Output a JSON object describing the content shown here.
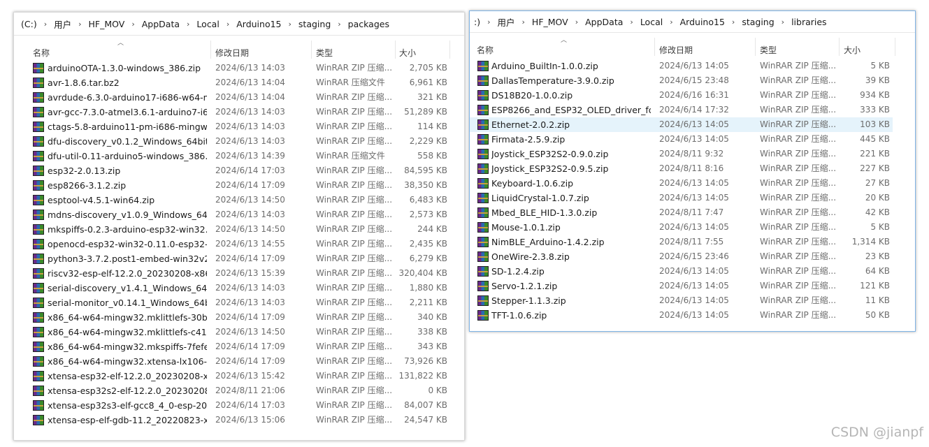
{
  "left_window": {
    "breadcrumb": [
      "(C:)",
      "用户",
      "HF_MOV",
      "AppData",
      "Local",
      "Arduino15",
      "staging",
      "packages"
    ],
    "columns": {
      "name": "名称",
      "date": "修改日期",
      "type": "类型",
      "size": "大小"
    },
    "files": [
      {
        "name": "arduinoOTA-1.3.0-windows_386.zip",
        "date": "2024/6/13 14:03",
        "type": "WinRAR ZIP 压缩...",
        "size": "2,705 KB"
      },
      {
        "name": "avr-1.8.6.tar.bz2",
        "date": "2024/6/13 14:04",
        "type": "WinRAR 压缩文件",
        "size": "6,961 KB"
      },
      {
        "name": "avrdude-6.3.0-arduino17-i686-w64-m...",
        "date": "2024/6/13 14:04",
        "type": "WinRAR ZIP 压缩...",
        "size": "321 KB"
      },
      {
        "name": "avr-gcc-7.3.0-atmel3.6.1-arduino7-i6...",
        "date": "2024/6/13 14:03",
        "type": "WinRAR ZIP 压缩...",
        "size": "51,289 KB"
      },
      {
        "name": "ctags-5.8-arduino11-pm-i686-mingw...",
        "date": "2024/6/13 14:03",
        "type": "WinRAR ZIP 压缩...",
        "size": "114 KB"
      },
      {
        "name": "dfu-discovery_v0.1.2_Windows_64bit....",
        "date": "2024/6/13 14:03",
        "type": "WinRAR ZIP 压缩...",
        "size": "2,229 KB"
      },
      {
        "name": "dfu-util-0.11-arduino5-windows_386.t...",
        "date": "2024/6/13 14:39",
        "type": "WinRAR 压缩文件",
        "size": "558 KB"
      },
      {
        "name": "esp32-2.0.13.zip",
        "date": "2024/6/14 17:03",
        "type": "WinRAR ZIP 压缩...",
        "size": "84,595 KB"
      },
      {
        "name": "esp8266-3.1.2.zip",
        "date": "2024/6/14 17:09",
        "type": "WinRAR ZIP 压缩...",
        "size": "38,350 KB"
      },
      {
        "name": "esptool-v4.5.1-win64.zip",
        "date": "2024/6/13 14:50",
        "type": "WinRAR ZIP 压缩...",
        "size": "6,483 KB"
      },
      {
        "name": "mdns-discovery_v1.0.9_Windows_64b...",
        "date": "2024/6/13 14:03",
        "type": "WinRAR ZIP 压缩...",
        "size": "2,573 KB"
      },
      {
        "name": "mkspiffs-0.2.3-arduino-esp32-win32....",
        "date": "2024/6/13 14:50",
        "type": "WinRAR ZIP 压缩...",
        "size": "244 KB"
      },
      {
        "name": "openocd-esp32-win32-0.11.0-esp32-...",
        "date": "2024/6/13 14:55",
        "type": "WinRAR ZIP 压缩...",
        "size": "2,435 KB"
      },
      {
        "name": "python3-3.7.2.post1-embed-win32v2...",
        "date": "2024/6/14 17:09",
        "type": "WinRAR ZIP 压缩...",
        "size": "6,279 KB"
      },
      {
        "name": "riscv32-esp-elf-12.2.0_20230208-x86_...",
        "date": "2024/6/13 15:39",
        "type": "WinRAR ZIP 压缩...",
        "size": "320,404 KB"
      },
      {
        "name": "serial-discovery_v1.4.1_Windows_64bi...",
        "date": "2024/6/13 14:03",
        "type": "WinRAR ZIP 压缩...",
        "size": "1,880 KB"
      },
      {
        "name": "serial-monitor_v0.14.1_Windows_64bi...",
        "date": "2024/6/13 14:03",
        "type": "WinRAR ZIP 压缩...",
        "size": "2,211 KB"
      },
      {
        "name": "x86_64-w64-mingw32.mklittlefs-30b7f...",
        "date": "2024/6/14 17:09",
        "type": "WinRAR ZIP 压缩...",
        "size": "340 KB"
      },
      {
        "name": "x86_64-w64-mingw32.mklittlefs-c41e...",
        "date": "2024/6/13 14:50",
        "type": "WinRAR ZIP 压缩...",
        "size": "338 KB"
      },
      {
        "name": "x86_64-w64-mingw32.mkspiffs-7fefea...",
        "date": "2024/6/14 17:09",
        "type": "WinRAR ZIP 压缩...",
        "size": "343 KB"
      },
      {
        "name": "x86_64-w64-mingw32.xtensa-lx106-el...",
        "date": "2024/6/14 17:09",
        "type": "WinRAR ZIP 压缩...",
        "size": "73,926 KB"
      },
      {
        "name": "xtensa-esp32-elf-12.2.0_20230208-x8...",
        "date": "2024/6/13 15:42",
        "type": "WinRAR ZIP 压缩...",
        "size": "131,822 KB"
      },
      {
        "name": "xtensa-esp32s2-elf-12.2.0_20230208-...",
        "date": "2024/8/11 21:06",
        "type": "WinRAR ZIP 压缩...",
        "size": "0 KB"
      },
      {
        "name": "xtensa-esp32s3-elf-gcc8_4_0-esp-202...",
        "date": "2024/6/14 17:03",
        "type": "WinRAR ZIP 压缩...",
        "size": "84,007 KB"
      },
      {
        "name": "xtensa-esp-elf-gdb-11.2_20220823-x...",
        "date": "2024/6/13 15:06",
        "type": "WinRAR ZIP 压缩...",
        "size": "24,547 KB"
      }
    ]
  },
  "right_window": {
    "breadcrumb": [
      ":)",
      "用户",
      "HF_MOV",
      "AppData",
      "Local",
      "Arduino15",
      "staging",
      "libraries"
    ],
    "columns": {
      "name": "名称",
      "date": "修改日期",
      "type": "类型",
      "size": "大小"
    },
    "selected_row": 4,
    "files": [
      {
        "name": "Arduino_BuiltIn-1.0.0.zip",
        "date": "2024/6/13 14:05",
        "type": "WinRAR ZIP 压缩...",
        "size": "5 KB"
      },
      {
        "name": "DallasTemperature-3.9.0.zip",
        "date": "2024/6/15 23:48",
        "type": "WinRAR ZIP 压缩...",
        "size": "39 KB"
      },
      {
        "name": "DS18B20-1.0.0.zip",
        "date": "2024/6/16 16:31",
        "type": "WinRAR ZIP 压缩...",
        "size": "934 KB"
      },
      {
        "name": "ESP8266_and_ESP32_OLED_driver_for...",
        "date": "2024/6/14 17:32",
        "type": "WinRAR ZIP 压缩...",
        "size": "333 KB"
      },
      {
        "name": "Ethernet-2.0.2.zip",
        "date": "2024/6/13 14:05",
        "type": "WinRAR ZIP 压缩...",
        "size": "103 KB"
      },
      {
        "name": "Firmata-2.5.9.zip",
        "date": "2024/6/13 14:05",
        "type": "WinRAR ZIP 压缩...",
        "size": "445 KB"
      },
      {
        "name": "Joystick_ESP32S2-0.9.0.zip",
        "date": "2024/8/11 9:32",
        "type": "WinRAR ZIP 压缩...",
        "size": "221 KB"
      },
      {
        "name": "Joystick_ESP32S2-0.9.5.zip",
        "date": "2024/8/11 8:16",
        "type": "WinRAR ZIP 压缩...",
        "size": "227 KB"
      },
      {
        "name": "Keyboard-1.0.6.zip",
        "date": "2024/6/13 14:05",
        "type": "WinRAR ZIP 压缩...",
        "size": "27 KB"
      },
      {
        "name": "LiquidCrystal-1.0.7.zip",
        "date": "2024/6/13 14:05",
        "type": "WinRAR ZIP 压缩...",
        "size": "20 KB"
      },
      {
        "name": "Mbed_BLE_HID-1.3.0.zip",
        "date": "2024/8/11 7:47",
        "type": "WinRAR ZIP 压缩...",
        "size": "42 KB"
      },
      {
        "name": "Mouse-1.0.1.zip",
        "date": "2024/6/13 14:05",
        "type": "WinRAR ZIP 压缩...",
        "size": "5 KB"
      },
      {
        "name": "NimBLE_Arduino-1.4.2.zip",
        "date": "2024/8/11 7:55",
        "type": "WinRAR ZIP 压缩...",
        "size": "1,314 KB"
      },
      {
        "name": "OneWire-2.3.8.zip",
        "date": "2024/6/15 23:46",
        "type": "WinRAR ZIP 压缩...",
        "size": "23 KB"
      },
      {
        "name": "SD-1.2.4.zip",
        "date": "2024/6/13 14:05",
        "type": "WinRAR ZIP 压缩...",
        "size": "64 KB"
      },
      {
        "name": "Servo-1.2.1.zip",
        "date": "2024/6/13 14:05",
        "type": "WinRAR ZIP 压缩...",
        "size": "121 KB"
      },
      {
        "name": "Stepper-1.1.3.zip",
        "date": "2024/6/13 14:05",
        "type": "WinRAR ZIP 压缩...",
        "size": "11 KB"
      },
      {
        "name": "TFT-1.0.6.zip",
        "date": "2024/6/13 14:05",
        "type": "WinRAR ZIP 压缩...",
        "size": "50 KB"
      }
    ]
  },
  "watermark": "CSDN @jianpf",
  "icons": {
    "crumb_separator": "chevron-right-icon",
    "sort": "sort-up-icon",
    "file": "winrar-archive-icon"
  },
  "colors": {
    "selected_row": "#e5f3fb",
    "active_border": "#7fb4e6"
  }
}
